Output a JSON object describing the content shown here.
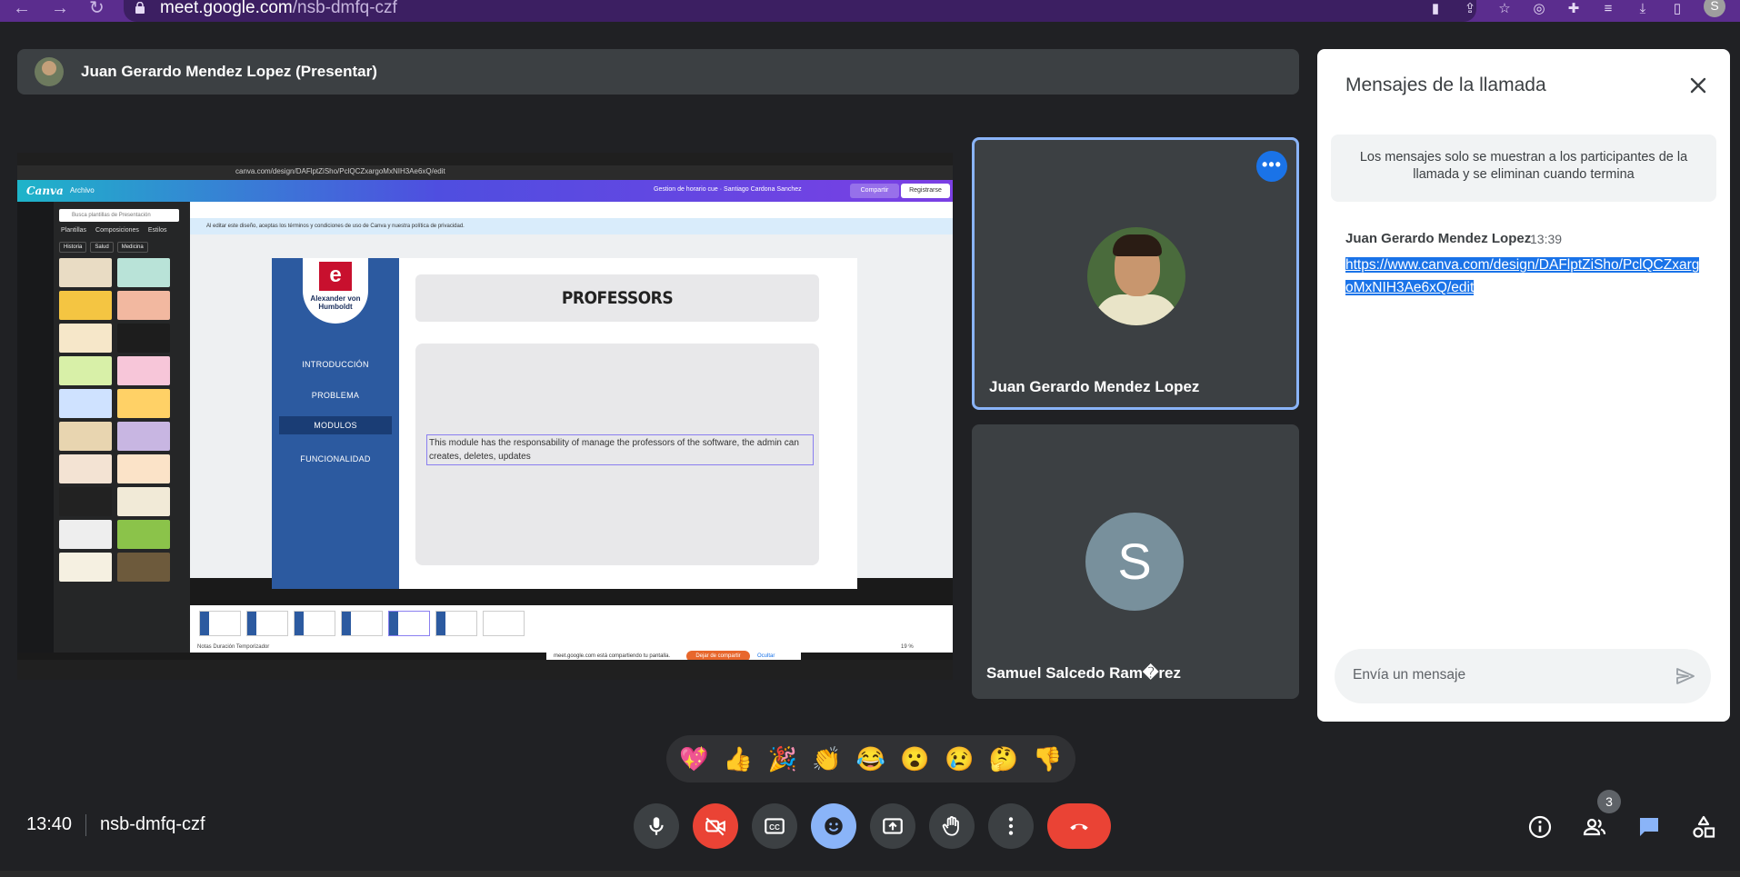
{
  "browser": {
    "url_host": "meet.google.com",
    "url_path": "/nsb-dmfq-czf",
    "profile_initial": "S"
  },
  "presenter": {
    "label": "Juan Gerardo Mendez Lopez (Presentar)"
  },
  "shared_screen": {
    "canva_url": "canva.com/design/DAFlptZiSho/PclQCZxargoMxNIH3Ae6xQ/edit",
    "canva_logo": "Canva",
    "file_menu": "Archivo",
    "doc_title": "Gestion de horario cue · Santiago Cardona Sanchez",
    "share_button": "Compartir",
    "register_button": "Registrarse",
    "search_placeholder": "Busca plantillas de Presentación",
    "panel_tabs": [
      "Plantillas",
      "Composiciones",
      "Estilos"
    ],
    "chips": [
      "Historia",
      "Salud",
      "Medicina"
    ],
    "notice": "Al editar este diseño, aceptas los términos y condiciones de uso de Canva y nuestra política de privacidad.",
    "slide": {
      "logo_letter": "e",
      "logo_name": "Alexander von Humboldt",
      "menu": [
        "INTRODUCCIÓN",
        "PROBLEMA",
        "MODULOS",
        "FUNCIONALIDAD"
      ],
      "title": "PROFESSORS",
      "body": "This module has the responsability of manage the professors of the software, the admin can creates, deletes, updates"
    },
    "status_items": "Notas   Duración   Temporizador",
    "zoom": "19 %",
    "sharing_text": "meet.google.com está compartiendo tu pantalla.",
    "stop_sharing": "Dejar de compartir",
    "hide": "Ocultar"
  },
  "participants": [
    {
      "name": "Juan Gerardo Mendez Lopez",
      "active_speaker": true
    },
    {
      "name": "Samuel Salcedo Ram�rez",
      "initial": "S",
      "avatar_color": "#78909c"
    }
  ],
  "chat": {
    "title": "Mensajes de la llamada",
    "notice": "Los mensajes solo se muestran a los participantes de la llamada y se eliminan cuando termina",
    "messages": [
      {
        "sender": "Juan Gerardo Mendez Lopez",
        "time": "13:39",
        "text": "https://www.canva.com/design/DAFlptZiSho/PclQCZxargoMxNIH3Ae6xQ/edit"
      }
    ],
    "input_placeholder": "Envía un mensaje"
  },
  "reactions": [
    "💖",
    "👍",
    "🎉",
    "👏",
    "😂",
    "😮",
    "😢",
    "🤔",
    "👎"
  ],
  "bottom": {
    "time": "13:40",
    "meeting_code": "nsb-dmfq-czf",
    "people_count": "3"
  },
  "colors": {
    "meet_bg": "#202124",
    "tile_bg": "#3c4043",
    "accent_blue": "#8ab4f8",
    "hangup_red": "#ea4335",
    "browser_purple": "#5b2d8e"
  }
}
